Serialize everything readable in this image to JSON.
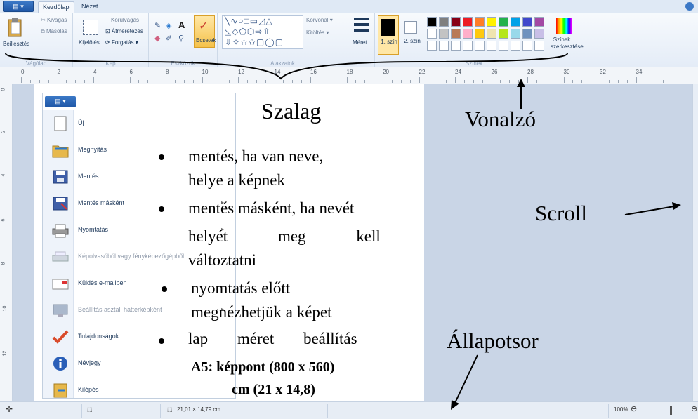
{
  "tabs": {
    "app_menu": "▤ ▾",
    "home": "Kezdőlap",
    "view": "Nézet"
  },
  "ribbon": {
    "clipboard": {
      "paste": "Beillesztés",
      "cut": "Kivágás",
      "copy": "Másolás",
      "group": "Vágólap"
    },
    "image": {
      "select": "Kijelölés",
      "crop": "Körülvágás",
      "resize": "Átméretezés",
      "rotate": "Forgatás ▾",
      "group": "Kép"
    },
    "tools": {
      "brushes": "Ecsetek",
      "group": "Eszközök"
    },
    "shapes": {
      "outline": "Körvonal ▾",
      "fill": "Kitöltés ▾",
      "group": "Alakzatok"
    },
    "size": {
      "label": "Méret"
    },
    "colors": {
      "color1": "1. szín",
      "color2": "2. szín",
      "edit": "Színek szerkesztése",
      "group": "Színek"
    }
  },
  "ruler_numbers": [
    "0",
    "2",
    "4",
    "6",
    "8",
    "10",
    "12",
    "14",
    "16",
    "18",
    "20",
    "22",
    "24",
    "26",
    "28",
    "30",
    "32",
    "34"
  ],
  "menu": {
    "items": [
      {
        "label": "Új",
        "icon": "new-file-icon",
        "arrow": false,
        "disabled": false
      },
      {
        "label": "Megnyitás",
        "icon": "open-folder-icon",
        "arrow": false,
        "disabled": false
      },
      {
        "label": "Mentés",
        "icon": "save-icon",
        "arrow": false,
        "disabled": false
      },
      {
        "label": "Mentés másként",
        "icon": "save-as-icon",
        "arrow": true,
        "disabled": false
      },
      {
        "label": "Nyomtatás",
        "icon": "printer-icon",
        "arrow": true,
        "disabled": false
      },
      {
        "label": "Képolvasóból vagy fényképezőgépből",
        "icon": "scanner-icon",
        "arrow": false,
        "disabled": true
      },
      {
        "label": "Küldés e-mailben",
        "icon": "email-icon",
        "arrow": false,
        "disabled": false
      },
      {
        "label": "Beállítás asztali háttérképként",
        "icon": "desktop-icon",
        "arrow": true,
        "disabled": true
      },
      {
        "label": "Tulajdonságok",
        "icon": "checkmark-icon",
        "arrow": false,
        "disabled": false
      },
      {
        "label": "Névjegy",
        "icon": "info-icon",
        "arrow": false,
        "disabled": false
      },
      {
        "label": "Kilépés",
        "icon": "exit-icon",
        "arrow": false,
        "disabled": false
      }
    ]
  },
  "annotations": {
    "ribbon": "Szalag",
    "ruler": "Vonalzó",
    "scroll": "Scroll",
    "statusbar": "Állapotsor",
    "bullets": [
      {
        "line1": "mentés, ha van neve,",
        "line2": "helye a képnek"
      },
      {
        "line1": "mentés másként, ha nevét",
        "line2": "helyét meg kell",
        "line3": "változtatni"
      },
      {
        "line1": "nyomtatás előtt",
        "line2": "megnézhetjük a képet"
      },
      {
        "line1": "lap méret beállítás",
        "line2": "A5: képpont (800 x 560)",
        "line3": "cm (21 x 14,8)"
      }
    ]
  },
  "statusbar": {
    "size": "21,01 × 14,79 cm",
    "zoom": "100%"
  },
  "palette_colors": [
    "#000000",
    "#7f7f7f",
    "#880015",
    "#ed1c24",
    "#ff7f27",
    "#fff200",
    "#22b14c",
    "#00a2e8",
    "#3f48cc",
    "#a349a4",
    "#ffffff",
    "#c3c3c3",
    "#b97a57",
    "#ffaec9",
    "#ffc90e",
    "#efe4b0",
    "#b5e61d",
    "#99d9ea",
    "#7092be",
    "#c8bfe7"
  ]
}
